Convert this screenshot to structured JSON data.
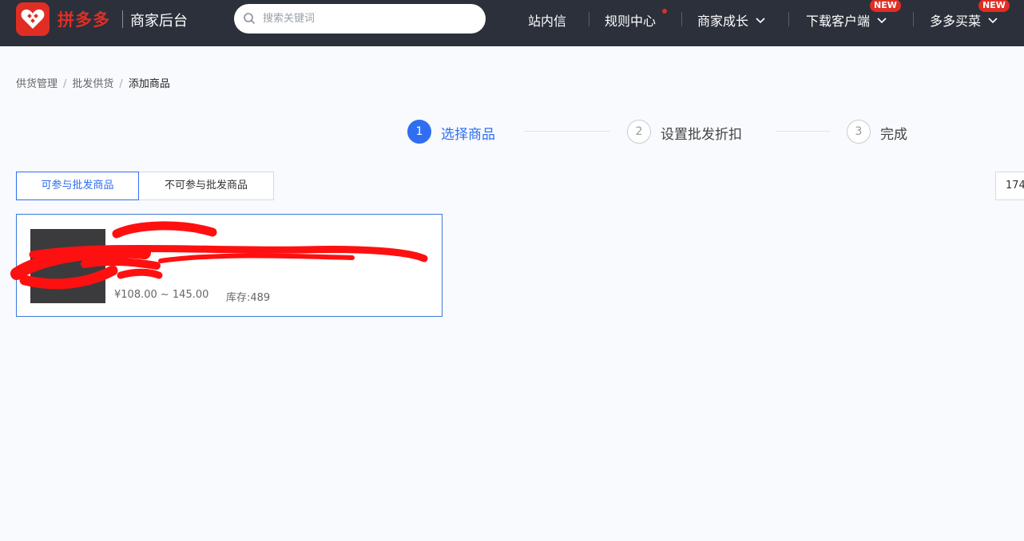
{
  "header": {
    "logo_text": "拼多多",
    "logo_subtitle": "商家后台",
    "search_placeholder": "搜索关键词",
    "nav": [
      {
        "label": "站内信"
      },
      {
        "label": "规则中心"
      },
      {
        "label": "商家成长"
      },
      {
        "label": "下载客户端",
        "badge": "NEW"
      },
      {
        "label": "多多买菜",
        "badge": "NEW"
      }
    ],
    "accent_color": "#e02e24"
  },
  "breadcrumb": [
    "供货管理",
    "批发供货",
    "添加商品"
  ],
  "steps": [
    {
      "number": "1",
      "label": "选择商品",
      "active": true
    },
    {
      "number": "2",
      "label": "设置批发折扣",
      "active": false
    },
    {
      "number": "3",
      "label": "完成",
      "active": false
    }
  ],
  "tabs": [
    {
      "label": "可参与批发商品",
      "active": true
    },
    {
      "label": "不可参与批发商品",
      "active": false
    }
  ],
  "count_label": "174",
  "product": {
    "price_range": "¥108.00 ~ 145.00",
    "stock": "库存:489"
  },
  "colors": {
    "primary": "#2f6ef1",
    "topbar": "#2b303b",
    "redaction": "#ff1010"
  }
}
